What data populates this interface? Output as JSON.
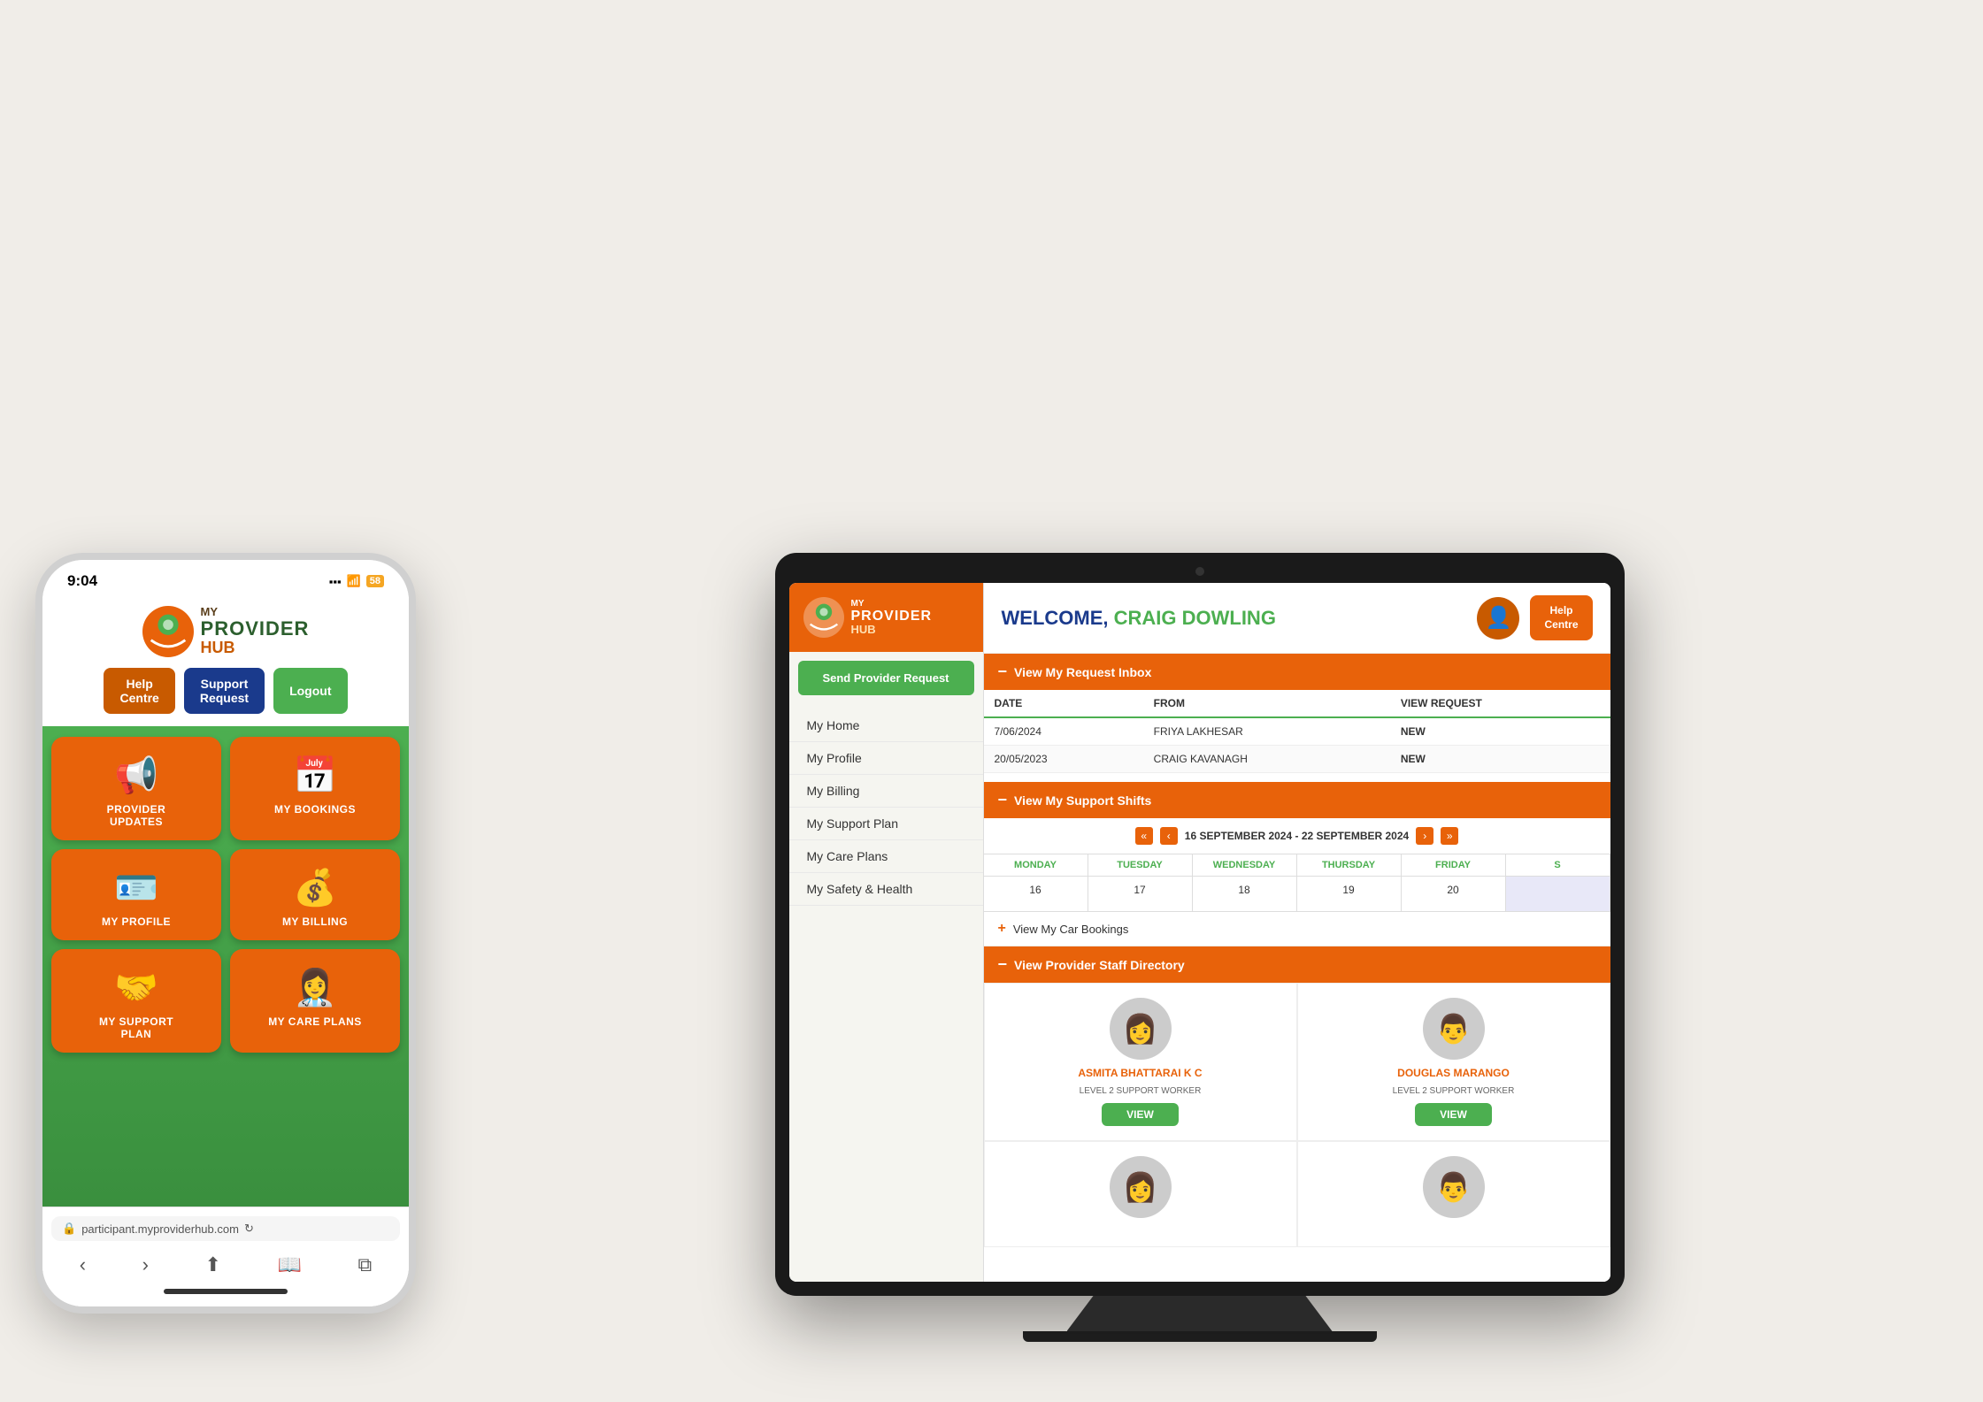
{
  "phone": {
    "status_time": "9:04",
    "status_icons": "📶 ⊞ 🔋 58",
    "logo_my": "MY",
    "logo_provider": "PROVIDER",
    "logo_hub": "HUB",
    "btn_help": "Help\nCentre",
    "btn_support": "Support\nRequest",
    "btn_logout": "Logout",
    "tiles": [
      {
        "label": "PROVIDER\nUPDATES",
        "icon": "📢"
      },
      {
        "label": "MY BOOKINGS",
        "icon": "📅"
      },
      {
        "label": "MY PROFILE",
        "icon": "🪪"
      },
      {
        "label": "MY BILLING",
        "icon": "💰"
      },
      {
        "label": "MY SUPPORT\nPLAN",
        "icon": "🤝"
      },
      {
        "label": "MY CARE PLANS",
        "icon": "👩‍⚕️"
      }
    ],
    "url": "participant.myproviderhub.com"
  },
  "tablet": {
    "logo_my": "MY",
    "logo_provider": "PROVIDER",
    "logo_hub": "HUB",
    "send_provider_btn": "Send Provider Request",
    "nav_items": [
      "My Home",
      "My Profile",
      "My Billing",
      "My Support Plan",
      "My Care Plans",
      "My Safety & Health"
    ],
    "welcome_prefix": "WELCOME, ",
    "welcome_name": "CRAIG DOWLING",
    "help_centre": "Help\nCentre",
    "sections": {
      "inbox": "View My Request Inbox",
      "shifts": "View My Support Shifts",
      "car": "View My Car Bookings",
      "staff": "View Provider Staff Directory"
    },
    "inbox_columns": [
      "DATE",
      "FROM",
      "VIEW REQUEST"
    ],
    "inbox_rows": [
      {
        "date": "7/06/2024",
        "from": "FRIYA LAKHESAR",
        "status": "NEW"
      },
      {
        "date": "20/05/2023",
        "from": "CRAIG KAVANAGH",
        "status": "NEW"
      }
    ],
    "week_label": "16 SEPTEMBER 2024 - 22 SEPTEMBER 2024",
    "calendar_headers": [
      "MONDAY",
      "TUESDAY",
      "WEDNESDAY",
      "THURSDAY",
      "FRIDAY",
      "S"
    ],
    "calendar_dates": [
      "16",
      "17",
      "18",
      "19",
      "20",
      ""
    ],
    "staff_cards": [
      {
        "name": "ASMITA BHATTARAI K C",
        "role": "LEVEL 2 SUPPORT WORKER",
        "icon": "👩"
      },
      {
        "name": "DOUGLAS MARANGO",
        "role": "LEVEL 2 SUPPORT WORKER",
        "icon": "👨"
      },
      {
        "name": "",
        "role": "",
        "icon": "👩"
      },
      {
        "name": "",
        "role": "",
        "icon": "👨"
      }
    ]
  },
  "colors": {
    "orange": "#e8620a",
    "green": "#4caf50",
    "dark_green": "#2c5f2e",
    "blue": "#1a3a8c",
    "white": "#ffffff"
  }
}
